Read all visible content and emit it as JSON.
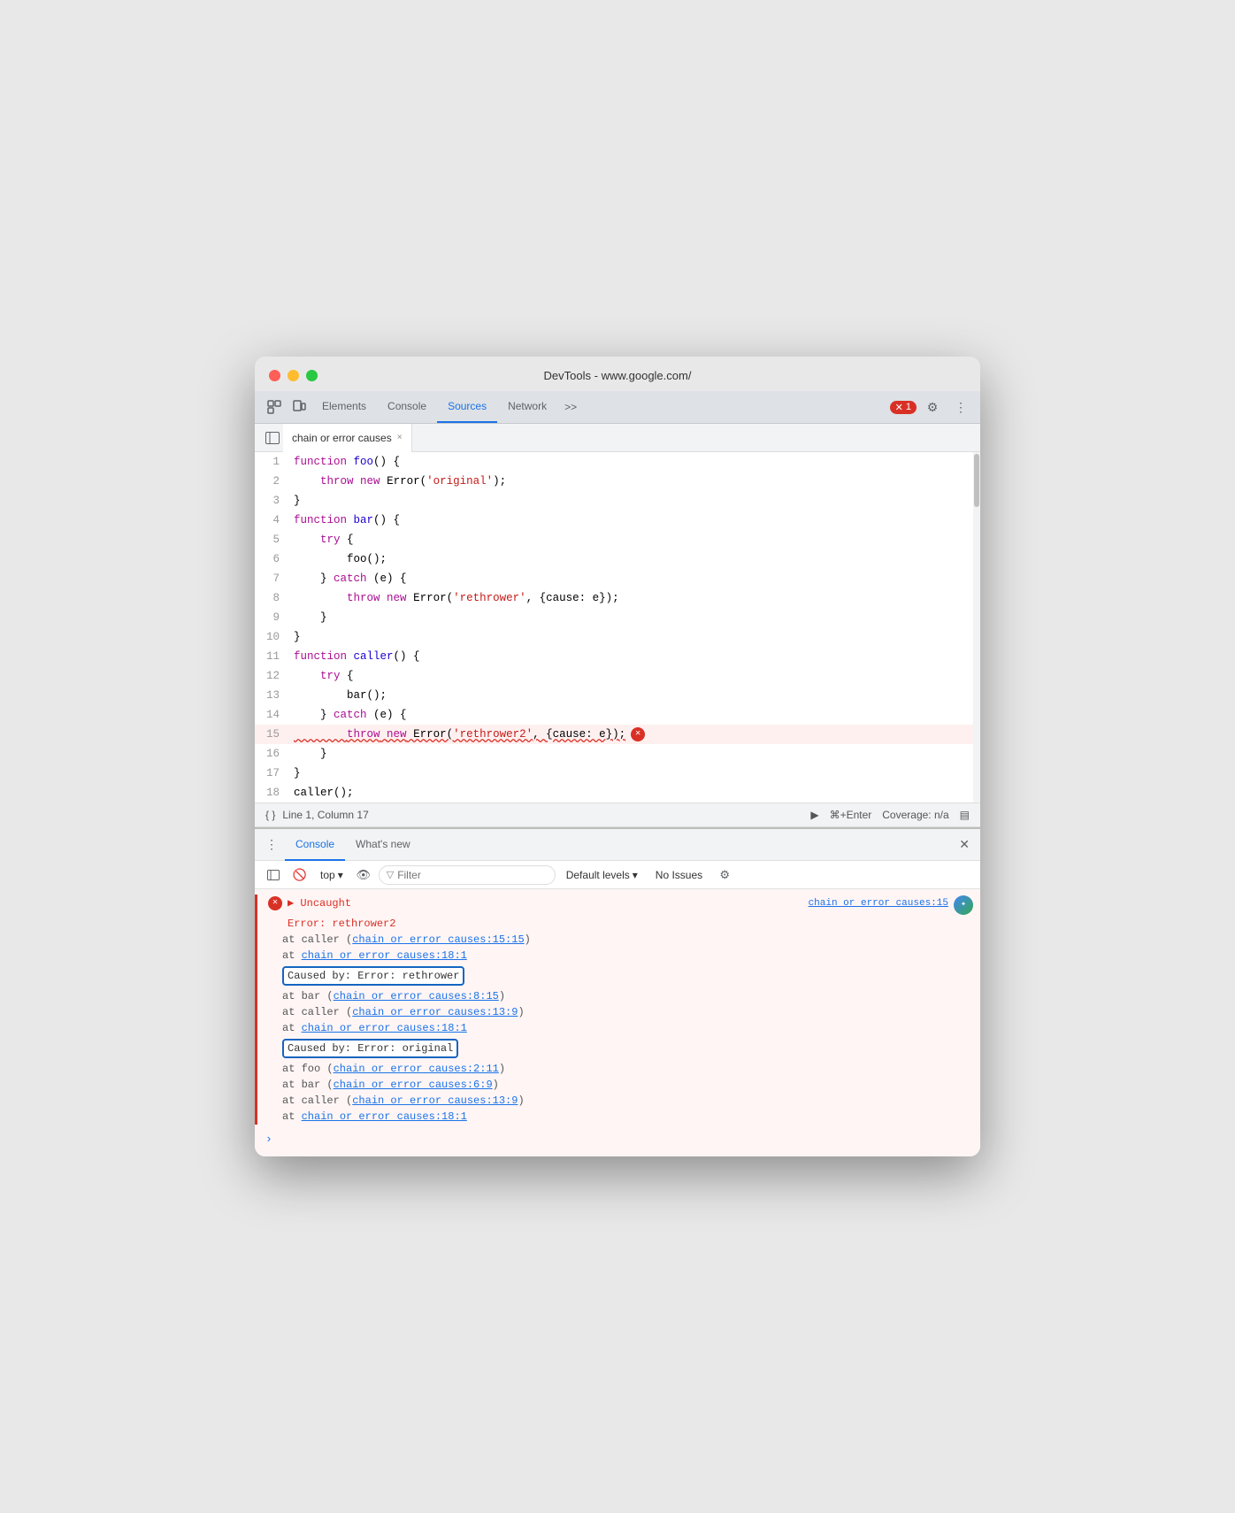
{
  "window": {
    "title": "DevTools - www.google.com/"
  },
  "titlebar_buttons": {
    "close": "×",
    "minimize": "–",
    "maximize": "+"
  },
  "devtools_tabs": {
    "tabs": [
      {
        "label": "Elements",
        "active": false
      },
      {
        "label": "Console",
        "active": false
      },
      {
        "label": "Sources",
        "active": true
      },
      {
        "label": "Network",
        "active": false
      }
    ],
    "more": ">>",
    "error_count": "1",
    "settings_icon": "⚙",
    "more_icon": "⋮"
  },
  "file_tab": {
    "label": "chain or error causes",
    "close": "×"
  },
  "code": {
    "lines": [
      {
        "num": 1,
        "text": "function foo() {",
        "error": false
      },
      {
        "num": 2,
        "text": "    throw new Error('original');",
        "error": false
      },
      {
        "num": 3,
        "text": "}",
        "error": false
      },
      {
        "num": 4,
        "text": "function bar() {",
        "error": false
      },
      {
        "num": 5,
        "text": "    try {",
        "error": false
      },
      {
        "num": 6,
        "text": "        foo();",
        "error": false
      },
      {
        "num": 7,
        "text": "    } catch (e) {",
        "error": false
      },
      {
        "num": 8,
        "text": "        throw new Error('rethrower', {cause: e});",
        "error": false
      },
      {
        "num": 9,
        "text": "    }",
        "error": false
      },
      {
        "num": 10,
        "text": "}",
        "error": false
      },
      {
        "num": 11,
        "text": "function caller() {",
        "error": false
      },
      {
        "num": 12,
        "text": "    try {",
        "error": false
      },
      {
        "num": 13,
        "text": "        bar();",
        "error": false
      },
      {
        "num": 14,
        "text": "    } catch (e) {",
        "error": false
      },
      {
        "num": 15,
        "text": "        throw new Error('rethrower2', {cause: e});",
        "error": true
      },
      {
        "num": 16,
        "text": "    }",
        "error": false
      },
      {
        "num": 17,
        "text": "}",
        "error": false
      },
      {
        "num": 18,
        "text": "caller();",
        "error": false
      }
    ]
  },
  "status_bar": {
    "braces": "{ }",
    "position": "Line 1, Column 17",
    "run_label": "⌘+Enter",
    "coverage": "Coverage: n/a",
    "icon": "▶"
  },
  "console": {
    "header": {
      "tabs": [
        {
          "label": "Console",
          "active": true
        },
        {
          "label": "What's new",
          "active": false
        }
      ]
    },
    "toolbar": {
      "top_label": "top",
      "filter_placeholder": "Filter",
      "default_levels": "Default levels",
      "no_issues": "No Issues"
    },
    "output": {
      "uncaught_label": "▶ Uncaught",
      "error_source": "chain or error causes:15",
      "error_line1": "Error: rethrower2",
      "at_caller_1": "at caller (",
      "link_caller_1": "chain or error causes:15:15",
      "at_chain_18_1": "at ",
      "link_chain_18_1": "chain or error causes:18:1",
      "caused_by_1": "Caused by: Error: rethrower",
      "at_bar_1": "at bar (",
      "link_bar_1": "chain or error causes:8:15",
      "at_caller_2": "at caller (",
      "link_caller_2": "chain or error causes:13:9",
      "at_chain_18_2": "at ",
      "link_chain_18_2": "chain or error causes:18:1",
      "caused_by_2": "Caused by: Error: original",
      "at_foo_1": "at foo (",
      "link_foo_1": "chain or error causes:2:11",
      "at_bar_2": "at bar (",
      "link_bar_2": "chain or error causes:6:9",
      "at_caller_3": "at caller (",
      "link_caller_3": "chain or error causes:13:9",
      "at_chain_18_3": "at ",
      "link_chain_18_3": "chain or error causes:18:1"
    }
  }
}
